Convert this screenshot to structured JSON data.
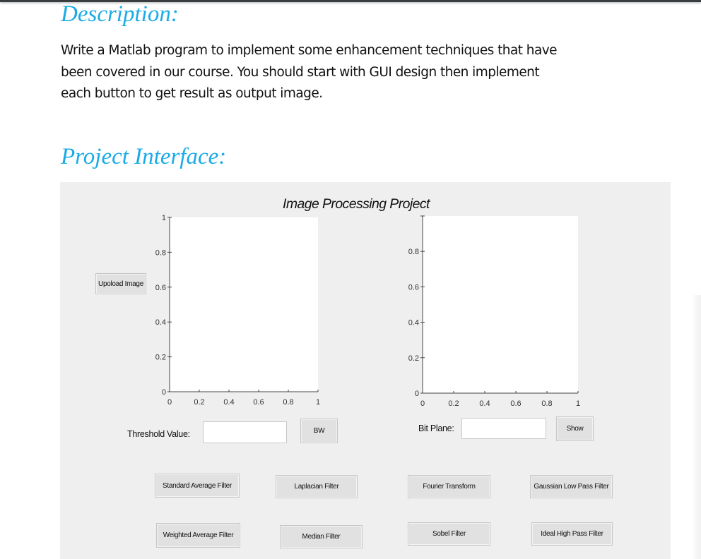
{
  "document": {
    "description_heading": "Description:",
    "description_lines": [
      "Write a Matlab program to implement some enhancement techniques that have",
      "been covered in our course. You should start with GUI design then implement",
      "each button to get result as output image."
    ],
    "interface_heading": "Project Interface:"
  },
  "gui": {
    "title": "Image Processing Project",
    "upload_button": "Upoload Image",
    "axes_left": {
      "x_ticks": [
        "0",
        "0.2",
        "0.4",
        "0.6",
        "0.8",
        "1"
      ],
      "y_ticks": [
        "0",
        "0.2",
        "0.4",
        "0.6",
        "0.8",
        "1"
      ],
      "xlim": [
        0,
        1
      ],
      "ylim": [
        0,
        1
      ]
    },
    "axes_right": {
      "x_ticks": [
        "0",
        "0.2",
        "0.4",
        "0.6",
        "0.8",
        "1"
      ],
      "y_ticks": [
        "0",
        "0.2",
        "0.4",
        "0.6",
        "0.8",
        ""
      ],
      "xlim": [
        0,
        1
      ],
      "ylim": [
        0,
        1
      ]
    },
    "threshold": {
      "label": "Threshold Value:",
      "value": "",
      "button": "BW"
    },
    "bit_plane": {
      "label": "Bit Plane:",
      "value": "",
      "button": "Show"
    },
    "filter_buttons": {
      "standard_average": "Standard Average Filter",
      "laplacian": "Laplacian Filter",
      "fourier": "Fourier Transform",
      "gaussian_low_pass": "Gaussian Low Pass Filter",
      "weighted_average": "Weighted Average Filter",
      "median": "Median Filter",
      "sobel": "Sobel Filter",
      "ideal_high_pass": "Ideal High Pass Filter"
    }
  }
}
